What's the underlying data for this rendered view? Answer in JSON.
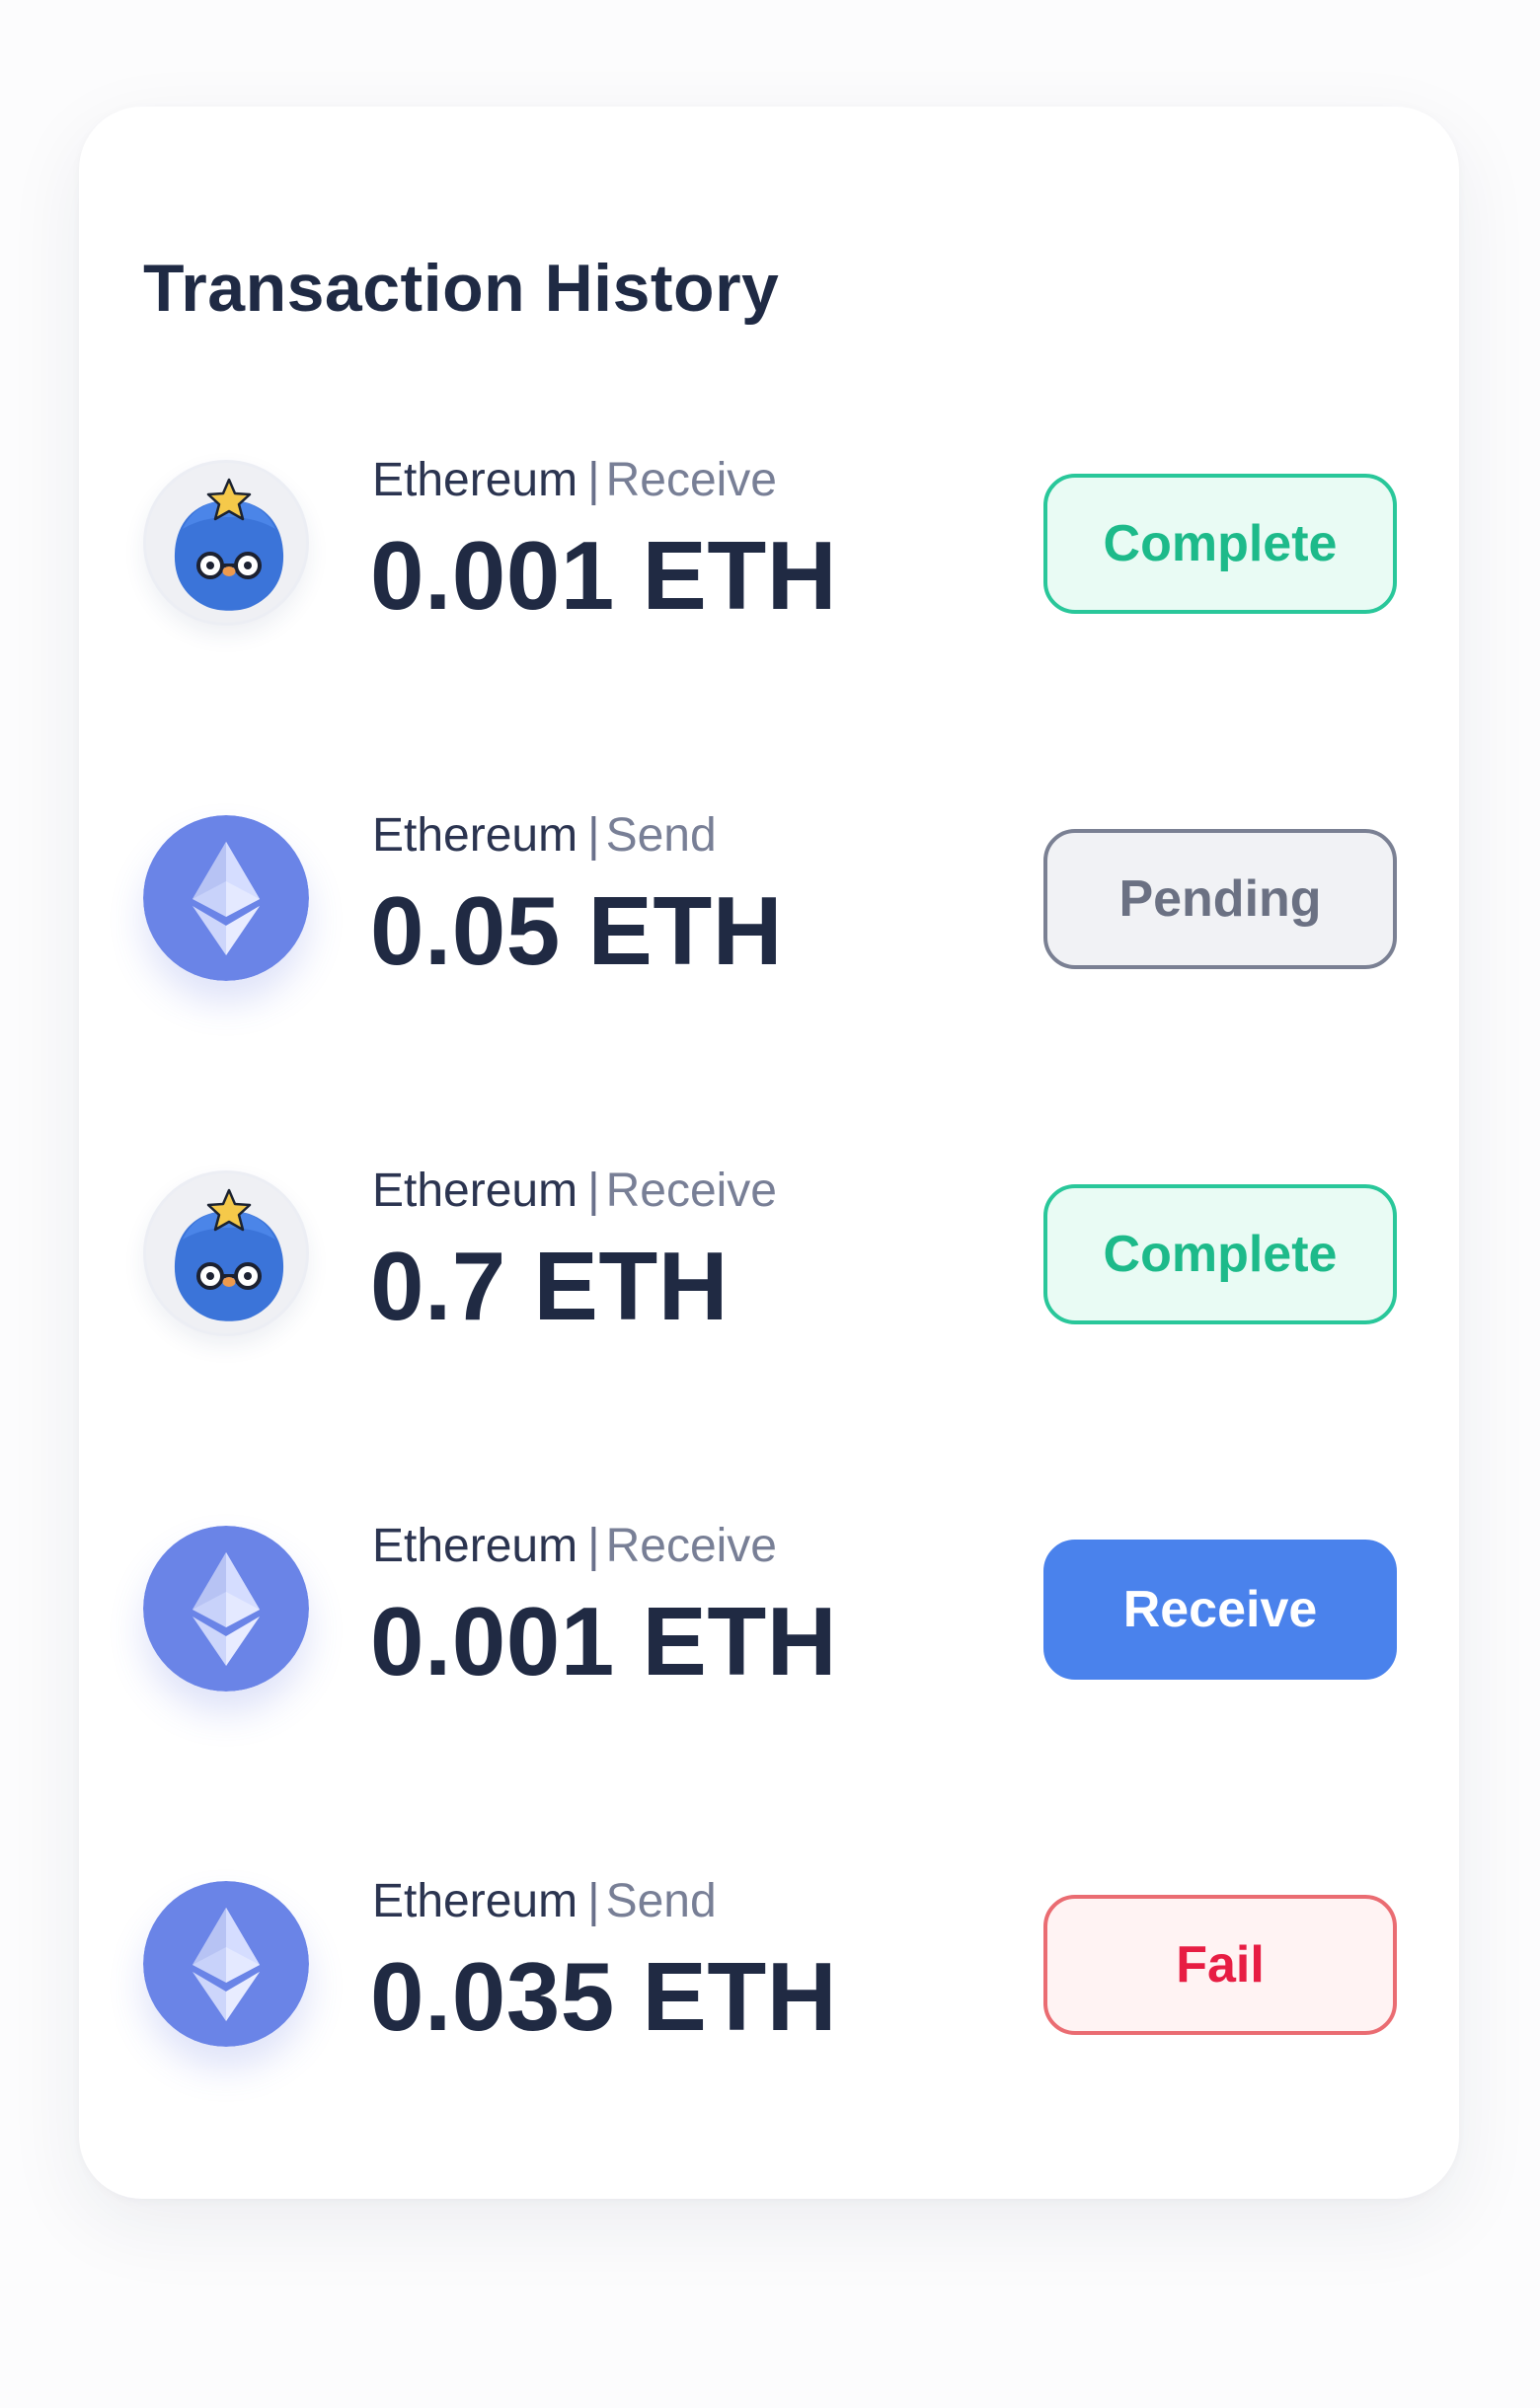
{
  "title": "Transaction History",
  "transactions": [
    {
      "avatar": "mascot-icon",
      "network": "Ethereum",
      "separator": "|",
      "type": "Receive",
      "amount": "0.001 ETH",
      "status": "Complete"
    },
    {
      "avatar": "ethereum-icon",
      "network": "Ethereum",
      "separator": "|",
      "type": "Send",
      "amount": "0.05 ETH",
      "status": "Pending"
    },
    {
      "avatar": "mascot-icon",
      "network": "Ethereum",
      "separator": "|",
      "type": "Receive",
      "amount": "0.7 ETH",
      "status": "Complete"
    },
    {
      "avatar": "ethereum-icon",
      "network": "Ethereum",
      "separator": "|",
      "type": "Receive",
      "amount": "0.001 ETH",
      "status": "Receive"
    },
    {
      "avatar": "ethereum-icon",
      "network": "Ethereum",
      "separator": "|",
      "type": "Send",
      "amount": "0.035 ETH",
      "status": "Fail"
    }
  ],
  "colors": {
    "complete": "#1dba8a",
    "pending": "#6b7183",
    "receive": "#4a82ec",
    "fail": "#e71d43",
    "ethereum": "#6a84e7",
    "text_primary": "#202a43"
  }
}
